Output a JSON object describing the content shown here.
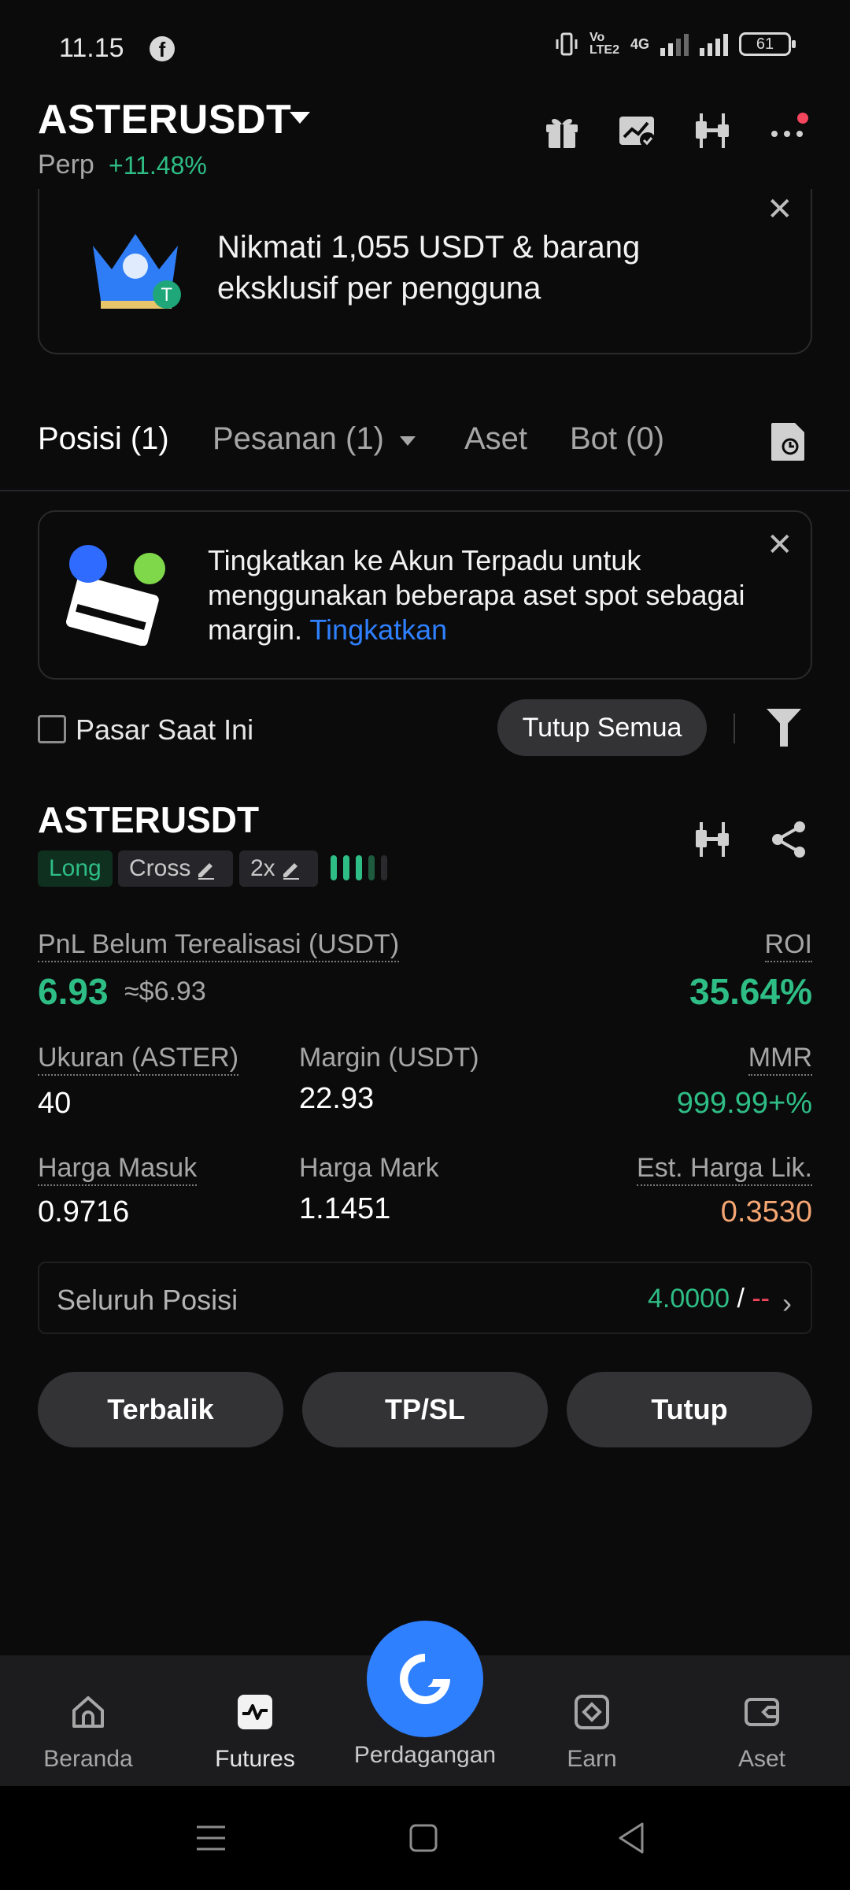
{
  "status_bar": {
    "time": "11.15",
    "app_icon": "facebook-icon",
    "network": "4G",
    "battery": "61"
  },
  "header": {
    "pair": "ASTERUSDT",
    "market_type": "Perp",
    "change": "+11.48%",
    "icons": [
      "gift-icon",
      "chart-check-icon",
      "candlestick-icon",
      "more-icon"
    ]
  },
  "promo": {
    "text": "Nikmati 1,055 USDT & barang eksklusif per pengguna",
    "close": "✕"
  },
  "tabs": [
    {
      "label": "Posisi (1)"
    },
    {
      "label": "Pesanan (1)"
    },
    {
      "label": "Aset"
    },
    {
      "label": "Bot (0)"
    }
  ],
  "upgrade": {
    "text": "Tingkatkan ke Akun Terpadu untuk menggunakan beberapa aset spot sebagai margin.",
    "link": "Tingkatkan",
    "close": "✕"
  },
  "filter": {
    "checkbox_label": "Pasar Saat Ini",
    "close_all": "Tutup Semua"
  },
  "position": {
    "symbol": "ASTERUSDT",
    "side": "Long",
    "margin_mode": "Cross",
    "leverage": "2x",
    "pnl_label": "PnL Belum Terealisasi (USDT)",
    "pnl_value": "6.93",
    "pnl_approx": "≈$6.93",
    "roi_label": "ROI",
    "roi_value": "35.64%",
    "size_label": "Ukuran (ASTER)",
    "size_value": "40",
    "margin_label": "Margin (USDT)",
    "margin_value": "22.93",
    "mmr_label": "MMR",
    "mmr_value": "999.99+%",
    "entry_label": "Harga Masuk",
    "entry_value": "0.9716",
    "mark_label": "Harga Mark",
    "mark_value": "1.1451",
    "liq_label": "Est. Harga Lik.",
    "liq_value": "0.3530",
    "all_position_label": "Seluruh Posisi",
    "all_position_value": "4.0000",
    "all_position_sep": " / ",
    "all_position_dash": "--"
  },
  "actions": {
    "reverse": "Terbalik",
    "tpsl": "TP/SL",
    "close": "Tutup"
  },
  "bottom_nav": [
    {
      "label": "Beranda",
      "icon": "home-icon"
    },
    {
      "label": "Futures",
      "icon": "futures-icon"
    },
    {
      "label": "Perdagangan",
      "icon": "trade-logo-icon"
    },
    {
      "label": "Earn",
      "icon": "earn-icon"
    },
    {
      "label": "Aset",
      "icon": "wallet-icon"
    }
  ],
  "colors": {
    "green": "#2ebd85",
    "blue": "#2f80ff",
    "orange": "#f5a673",
    "red": "#f6465d"
  }
}
